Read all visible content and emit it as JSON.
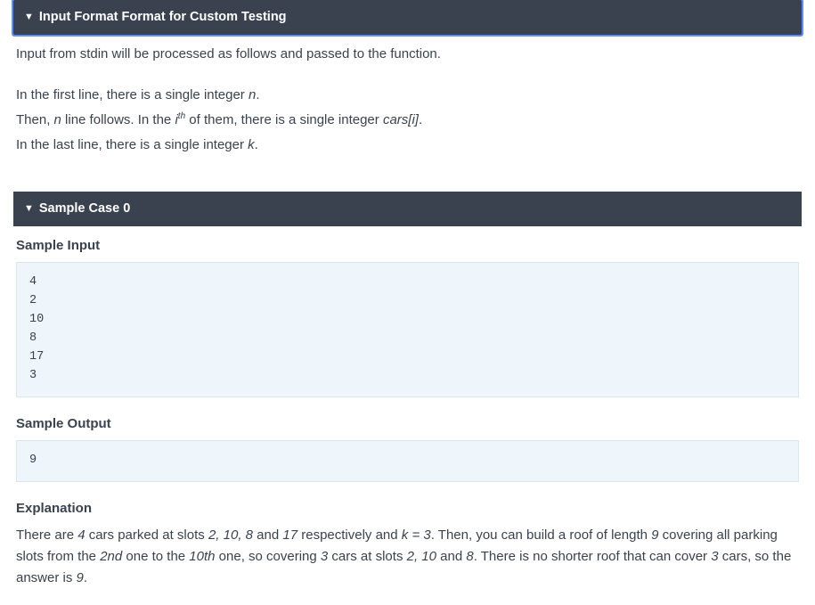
{
  "panel1": {
    "title": "Input Format Format for Custom Testing",
    "intro": "Input from stdin will be processed as follows and passed to the function.",
    "line1_prefix": "In the first line, there is a single integer ",
    "line1_var": "n",
    "line1_suffix": ".",
    "line2_prefix": "Then, ",
    "line2_var": "n",
    "line2_mid1": " line follows. In the ",
    "line2_i": "i",
    "line2_th": "th",
    "line2_mid2": " of them, there is a single integer ",
    "line2_cars": "cars[i]",
    "line2_suffix": ".",
    "line3_prefix": "In the last line, there is a single integer ",
    "line3_var": "k",
    "line3_suffix": "."
  },
  "panel2": {
    "title": "Sample Case 0",
    "sample_input_label": "Sample Input",
    "sample_input": "4\n2\n10\n8\n17\n3",
    "sample_output_label": "Sample Output",
    "sample_output": "9",
    "explanation_label": "Explanation",
    "exp_parts": {
      "p1": "There are ",
      "n4": "4",
      "p2": " cars parked at slots ",
      "slots": "2, 10, 8",
      "p3": " and ",
      "s17": "17",
      "p4": " respectively and ",
      "kexpr": "k = 3",
      "p5": ". Then, you can build a roof of length ",
      "n9a": "9",
      "p6": " covering all parking slots from the ",
      "s2nd": "2nd",
      "p7": " one to the ",
      "s10th": "10th",
      "p8": " one, so covering ",
      "n3a": "3",
      "p9": " cars at slots ",
      "s210": "2, 10",
      "p10": " and ",
      "s8": "8",
      "p11": ". There is no shorter roof that can cover ",
      "n3b": "3",
      "p12": " cars, so the answer is ",
      "n9b": "9",
      "p13": "."
    }
  }
}
